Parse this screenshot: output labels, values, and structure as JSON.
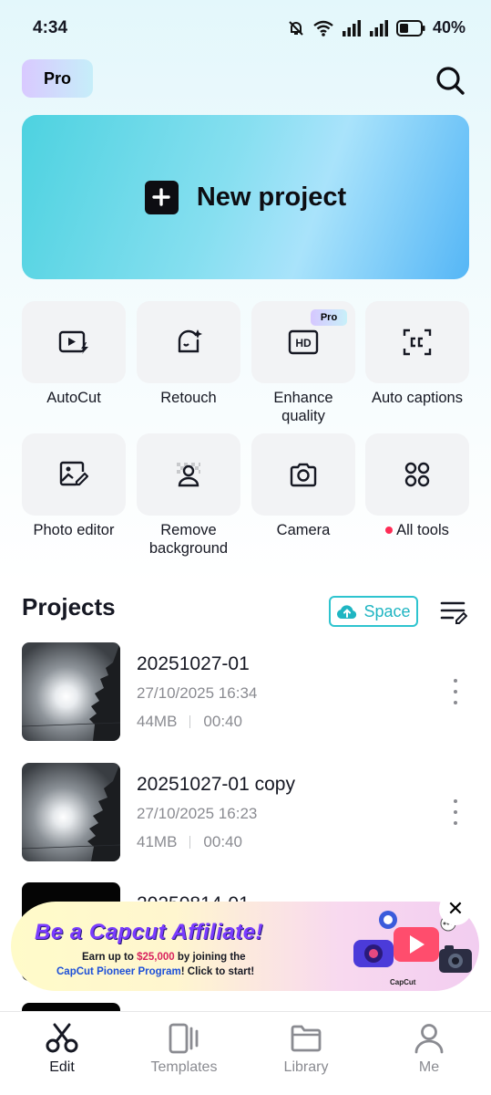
{
  "status_bar": {
    "time": "4:34",
    "battery": "40%"
  },
  "header": {
    "pro_badge": "Pro",
    "search_icon": "search-icon"
  },
  "new_project": {
    "label": "New project",
    "icon": "plus-icon"
  },
  "tools": [
    {
      "label": "AutoCut",
      "icon": "autocut-icon"
    },
    {
      "label": "Retouch",
      "icon": "retouch-icon"
    },
    {
      "label": "Enhance quality",
      "icon": "hd-icon",
      "badge": "Pro"
    },
    {
      "label": "Auto captions",
      "icon": "captions-icon"
    },
    {
      "label": "Photo editor",
      "icon": "photo-edit-icon"
    },
    {
      "label": "Remove background",
      "icon": "remove-bg-icon"
    },
    {
      "label": "Camera",
      "icon": "camera-icon"
    },
    {
      "label": "All tools",
      "icon": "grid-icon"
    }
  ],
  "projects": {
    "title": "Projects",
    "space_label": "Space",
    "items": [
      {
        "name": "20251027-01",
        "date": "27/10/2025 16:34",
        "size": "44MB",
        "duration": "00:40"
      },
      {
        "name": "20251027-01 copy",
        "date": "27/10/2025 16:23",
        "size": "41MB",
        "duration": "00:40"
      },
      {
        "name": "20250814-01"
      }
    ]
  },
  "ad": {
    "headline": "Be a Capcut Affiliate!",
    "line1_pre": "Earn up to ",
    "line1_amount": "$25,000",
    "line1_post": " by joining the",
    "line2_program": "CapCut Pioneer Program",
    "line2_post": "! Click to start!",
    "brand": "CapCut",
    "close": "✕"
  },
  "bottom_nav": [
    {
      "label": "Edit",
      "icon": "scissors-icon",
      "active": true
    },
    {
      "label": "Templates",
      "icon": "templates-icon"
    },
    {
      "label": "Library",
      "icon": "folder-icon"
    },
    {
      "label": "Me",
      "icon": "user-icon"
    }
  ],
  "colors": {
    "accent_teal": "#2ec4cf",
    "notification_red": "#fe2c55",
    "text_primary": "#161823",
    "text_secondary": "#8a8b91"
  }
}
